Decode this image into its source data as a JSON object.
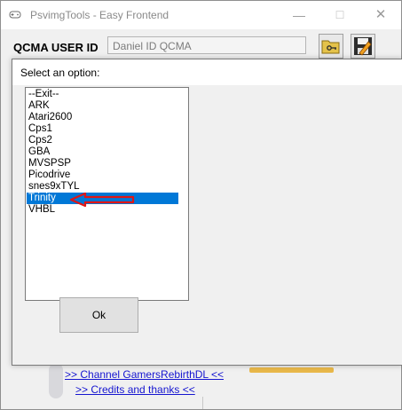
{
  "window": {
    "title": "PsvimgTools - Easy Frontend",
    "controls": {
      "minimize": "—",
      "maximize": "☐",
      "close": "✕"
    }
  },
  "qcma": {
    "label": "QCMA USER ID",
    "value": "Daniel ID QCMA"
  },
  "toolbar": {
    "folder_icon": "folder-key-icon",
    "save_icon": "floppy-save-icon"
  },
  "background_links": {
    "channel": ">> Channel GamersRebirthDL <<",
    "credits": ">> Credits and thanks <<"
  },
  "dialog": {
    "title": "Select an option:",
    "options": [
      "--Exit--",
      "ARK",
      "Atari2600",
      "Cps1",
      "Cps2",
      "GBA",
      "MVSPSP",
      "Picodrive",
      "snes9xTYL",
      "Trinity",
      "VHBL"
    ],
    "selected_option": "Trinity",
    "ok_label": "Ok"
  },
  "colors": {
    "selection": "#0078d7",
    "annotation_arrow": "#e01616",
    "link": "#1515d0"
  }
}
